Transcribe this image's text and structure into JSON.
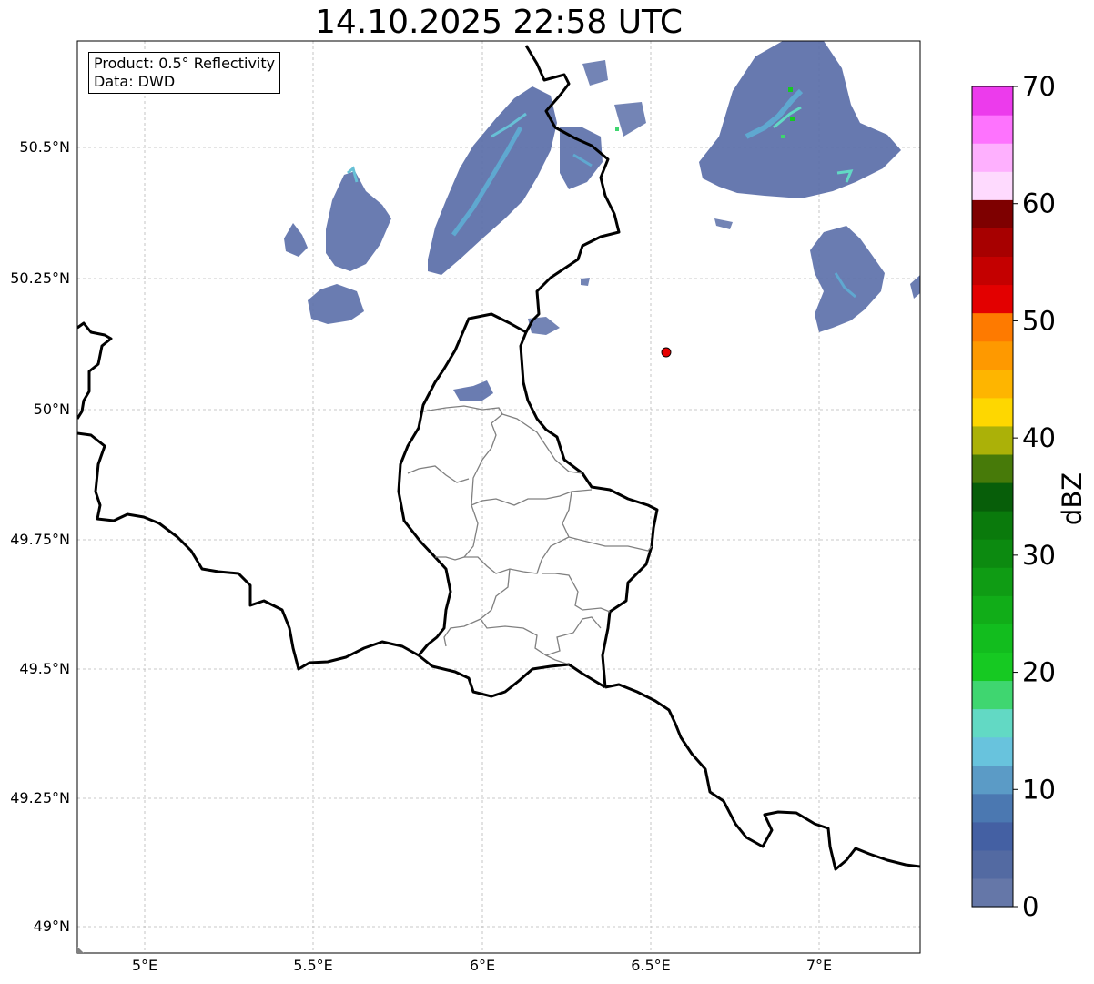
{
  "title": "14.10.2025 22:58 UTC",
  "info": {
    "product": "Product: 0.5° Reflectivity",
    "data": "Data: DWD"
  },
  "axes": {
    "lon_ticks": [
      "5°E",
      "5.5°E",
      "6°E",
      "6.5°E",
      "7°E"
    ],
    "lat_ticks": [
      "50.5°N",
      "50.25°N",
      "50°N",
      "49.75°N",
      "49.5°N",
      "49.25°N",
      "49°N"
    ]
  },
  "colorbar": {
    "label": "dBZ",
    "ticks": [
      "0",
      "10",
      "20",
      "30",
      "40",
      "50",
      "60",
      "70"
    ],
    "colors": [
      "#6577a8",
      "#536aa2",
      "#4460a3",
      "#4b78b1",
      "#5b9bc6",
      "#68c3dd",
      "#62d9c4",
      "#3fd670",
      "#16c922",
      "#12bd1e",
      "#11ad18",
      "#0f9c14",
      "#0c8a10",
      "#0a7a0c",
      "#075e09",
      "#477a09",
      "#abb108",
      "#fed700",
      "#feb500",
      "#fe9900",
      "#fe7a00",
      "#e30000",
      "#c40000",
      "#a70000",
      "#7e0000",
      "#fedafe",
      "#feb0fe",
      "#fe73fe",
      "#ec3bec"
    ]
  },
  "radar_site": {
    "label": "radar-site",
    "color": "#e60000"
  }
}
